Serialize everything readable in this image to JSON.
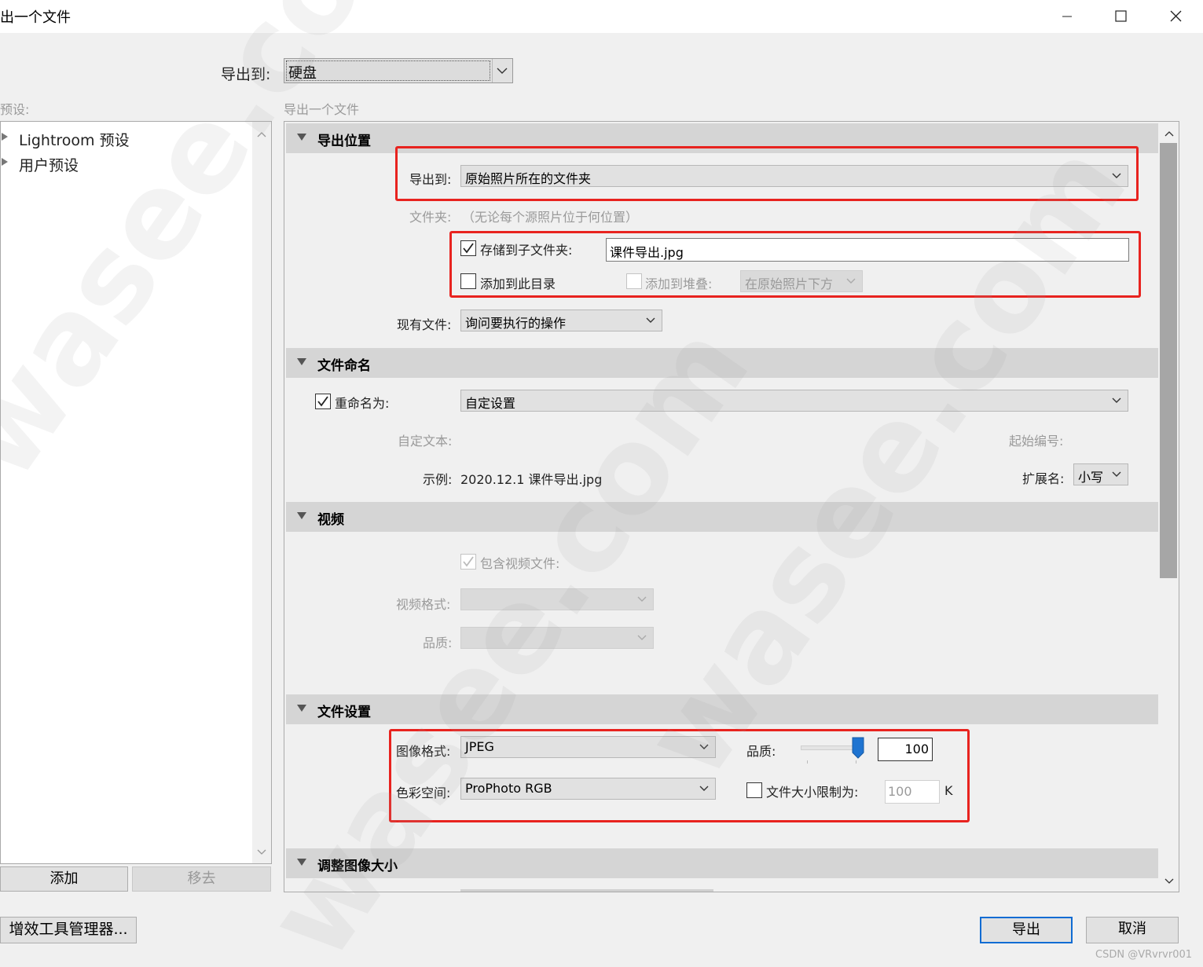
{
  "window": {
    "title": "出一个文件",
    "min_icon": "minimize-icon",
    "max_icon": "maximize-icon",
    "close_icon": "close-icon"
  },
  "top": {
    "export_to_label": "导出到:",
    "export_to_value": "硬盘"
  },
  "presets": {
    "label": "预设:",
    "items": [
      "Lightroom 预设",
      "用户预设"
    ],
    "add_button": "添加",
    "remove_button": "移去"
  },
  "panel_title": "导出一个文件",
  "export_location": {
    "header": "导出位置",
    "export_to_label": "导出到:",
    "export_to_value": "原始照片所在的文件夹",
    "folder_label": "文件夹:",
    "folder_value": "（无论每个源照片位于何位置）",
    "subfolder_label": "存储到子文件夹:",
    "subfolder_checked": true,
    "subfolder_value": "课件导出.jpg",
    "add_catalog_label": "添加到此目录",
    "add_stack_label": "添加到堆叠:",
    "stack_position": "在原始照片下方",
    "existing_label": "现有文件:",
    "existing_value": "询问要执行的操作"
  },
  "file_naming": {
    "header": "文件命名",
    "rename_label": "重命名为:",
    "rename_checked": true,
    "rename_value": "自定设置",
    "custom_text_label": "自定文本:",
    "start_number_label": "起始编号:",
    "example_label": "示例:",
    "example_value": "2020.12.1 课件导出.jpg",
    "extension_label": "扩展名:",
    "extension_value": "小写"
  },
  "video": {
    "header": "视频",
    "include_label": "包含视频文件:",
    "format_label": "视频格式:",
    "quality_label": "品质:"
  },
  "file_settings": {
    "header": "文件设置",
    "format_label": "图像格式:",
    "format_value": "JPEG",
    "quality_label": "品质:",
    "quality_value": "100",
    "quality_fraction": 1.0,
    "colorspace_label": "色彩空间:",
    "colorspace_value": "ProPhoto RGB",
    "limit_label": "文件大小限制为:",
    "limit_value": "100",
    "limit_unit": "K"
  },
  "resize": {
    "header": "调整图像大小"
  },
  "footer": {
    "plugin_button": "增效工具管理器...",
    "export_button": "导出",
    "cancel_button": "取消",
    "credit": "CSDN @VRvrvr001"
  },
  "colors": {
    "highlight_red": "#e8231f",
    "accent_blue": "#1f74d1",
    "section_gray": "#d5d5d5"
  }
}
